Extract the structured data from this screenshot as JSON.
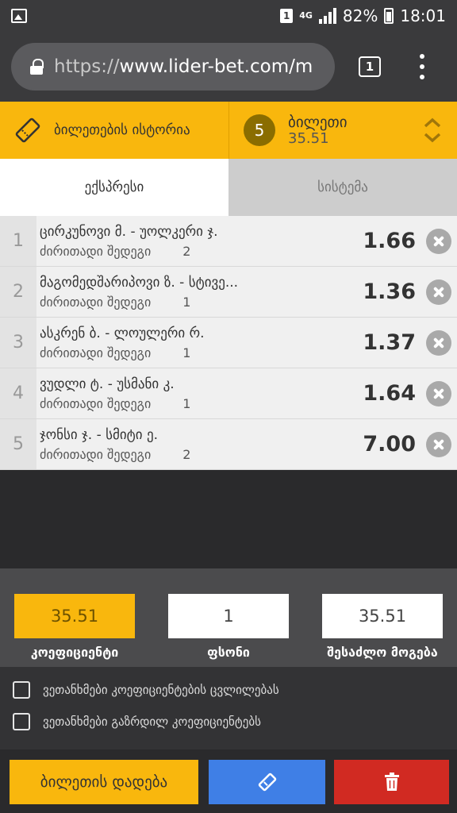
{
  "status_bar": {
    "battery": "82%",
    "time": "18:01",
    "sim": "1",
    "network": "4G"
  },
  "browser": {
    "url_scheme": "https://",
    "url_rest": "www.lider-bet.com/m",
    "tab_count": "1"
  },
  "header": {
    "history_label": "ბილეთების ისტორია",
    "ticket_count": "5",
    "ticket_title": "ბილეთი",
    "ticket_total": "35.51"
  },
  "type_tabs": {
    "express": "ექსპრესი",
    "system": "სისტემა"
  },
  "bets": [
    {
      "num": "1",
      "match": "ცირკუნოვი მ. - უოლკერი ჯ.",
      "market": "ძირითადი შედეგი",
      "pick": "2",
      "odd": "1.66"
    },
    {
      "num": "2",
      "match": "მაგომედშარიპოვი ზ. - სტივე...",
      "market": "ძირითადი შედეგი",
      "pick": "1",
      "odd": "1.36"
    },
    {
      "num": "3",
      "match": "ასკრენ ბ. - ლოულერი რ.",
      "market": "ძირითადი შედეგი",
      "pick": "1",
      "odd": "1.37"
    },
    {
      "num": "4",
      "match": "ვუდლი ტ. - უსმანი კ.",
      "market": "ძირითადი შედეგი",
      "pick": "1",
      "odd": "1.64"
    },
    {
      "num": "5",
      "match": "ჯონსი ჯ. - სმიტი ე.",
      "market": "ძირითადი შედეგი",
      "pick": "2",
      "odd": "7.00"
    }
  ],
  "totals": {
    "coef_value": "35.51",
    "coef_label": "კოეფიციენტი",
    "stake_value": "1",
    "stake_label": "ფსონი",
    "win_value": "35.51",
    "win_label": "შესაძლო მოგება"
  },
  "agreements": {
    "odds_change": "ვეთანხმები კოეფიციენტების ცვლილებას",
    "odds_increase": "ვეთანხმები გაზრდილ კოეფიციენტებს"
  },
  "actions": {
    "place_label": "ბილეთის დადება"
  },
  "colors": {
    "accent": "#f9b70d",
    "share": "#3f7fe6",
    "delete": "#d12a22"
  }
}
